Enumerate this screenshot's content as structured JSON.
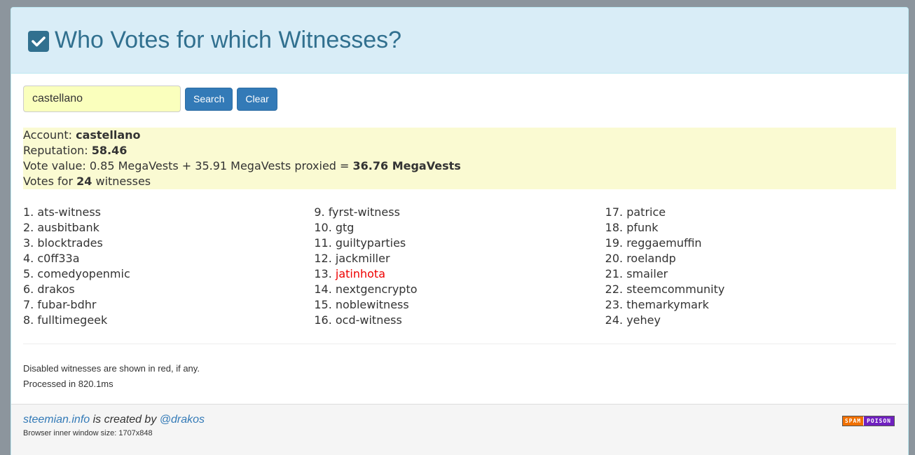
{
  "header": {
    "title": "Who Votes for which Witnesses?",
    "icon": "check-square-icon",
    "color": "#31708f"
  },
  "search": {
    "value": "castellano",
    "search_label": "Search",
    "clear_label": "Clear"
  },
  "account": {
    "account_label": "Account: ",
    "name": "castellano",
    "reputation_label": "Reputation: ",
    "reputation": "58.46",
    "vote_value_label": "Vote value: ",
    "own_vests": "0.85 MegaVests",
    "plus": " + ",
    "proxied_vests": "35.91 MegaVests proxied",
    "equals": " = ",
    "total_vests": "36.76 MegaVests",
    "votes_for_label": "Votes for ",
    "witness_count": "24",
    "witnesses_label": " witnesses"
  },
  "witnesses": [
    {
      "num": "1.",
      "name": "ats-witness",
      "disabled": false
    },
    {
      "num": "2.",
      "name": "ausbitbank",
      "disabled": false
    },
    {
      "num": "3.",
      "name": "blocktrades",
      "disabled": false
    },
    {
      "num": "4.",
      "name": "c0ff33a",
      "disabled": false
    },
    {
      "num": "5.",
      "name": "comedyopenmic",
      "disabled": false
    },
    {
      "num": "6.",
      "name": "drakos",
      "disabled": false
    },
    {
      "num": "7.",
      "name": "fubar-bdhr",
      "disabled": false
    },
    {
      "num": "8.",
      "name": "fulltimegeek",
      "disabled": false
    },
    {
      "num": "9.",
      "name": "fyrst-witness",
      "disabled": false
    },
    {
      "num": "10.",
      "name": "gtg",
      "disabled": false
    },
    {
      "num": "11.",
      "name": "guiltyparties",
      "disabled": false
    },
    {
      "num": "12.",
      "name": "jackmiller",
      "disabled": false
    },
    {
      "num": "13.",
      "name": "jatinhota",
      "disabled": true
    },
    {
      "num": "14.",
      "name": "nextgencrypto",
      "disabled": false
    },
    {
      "num": "15.",
      "name": "noblewitness",
      "disabled": false
    },
    {
      "num": "16.",
      "name": "ocd-witness",
      "disabled": false
    },
    {
      "num": "17.",
      "name": "patrice",
      "disabled": false
    },
    {
      "num": "18.",
      "name": "pfunk",
      "disabled": false
    },
    {
      "num": "19.",
      "name": "reggaemuffin",
      "disabled": false
    },
    {
      "num": "20.",
      "name": "roelandp",
      "disabled": false
    },
    {
      "num": "21.",
      "name": "smailer",
      "disabled": false
    },
    {
      "num": "22.",
      "name": "steemcommunity",
      "disabled": false
    },
    {
      "num": "23.",
      "name": "themarkymark",
      "disabled": false
    },
    {
      "num": "24.",
      "name": "yehey",
      "disabled": false
    }
  ],
  "notes": {
    "disabled_note": "Disabled witnesses are shown in red, if any.",
    "processed": "Processed in 820.1ms"
  },
  "footer": {
    "site_link": "steemian.info",
    "created_by": " is created by ",
    "author_link": "@drakos",
    "window_size": "Browser inner window size: 1707x848",
    "badge_left": "SPAM",
    "badge_right": "POISON"
  },
  "colors": {
    "disabled": "#ee0000",
    "button": "#337ab7",
    "input_bg": "#faffbd",
    "info_bg": "#fafad2"
  }
}
